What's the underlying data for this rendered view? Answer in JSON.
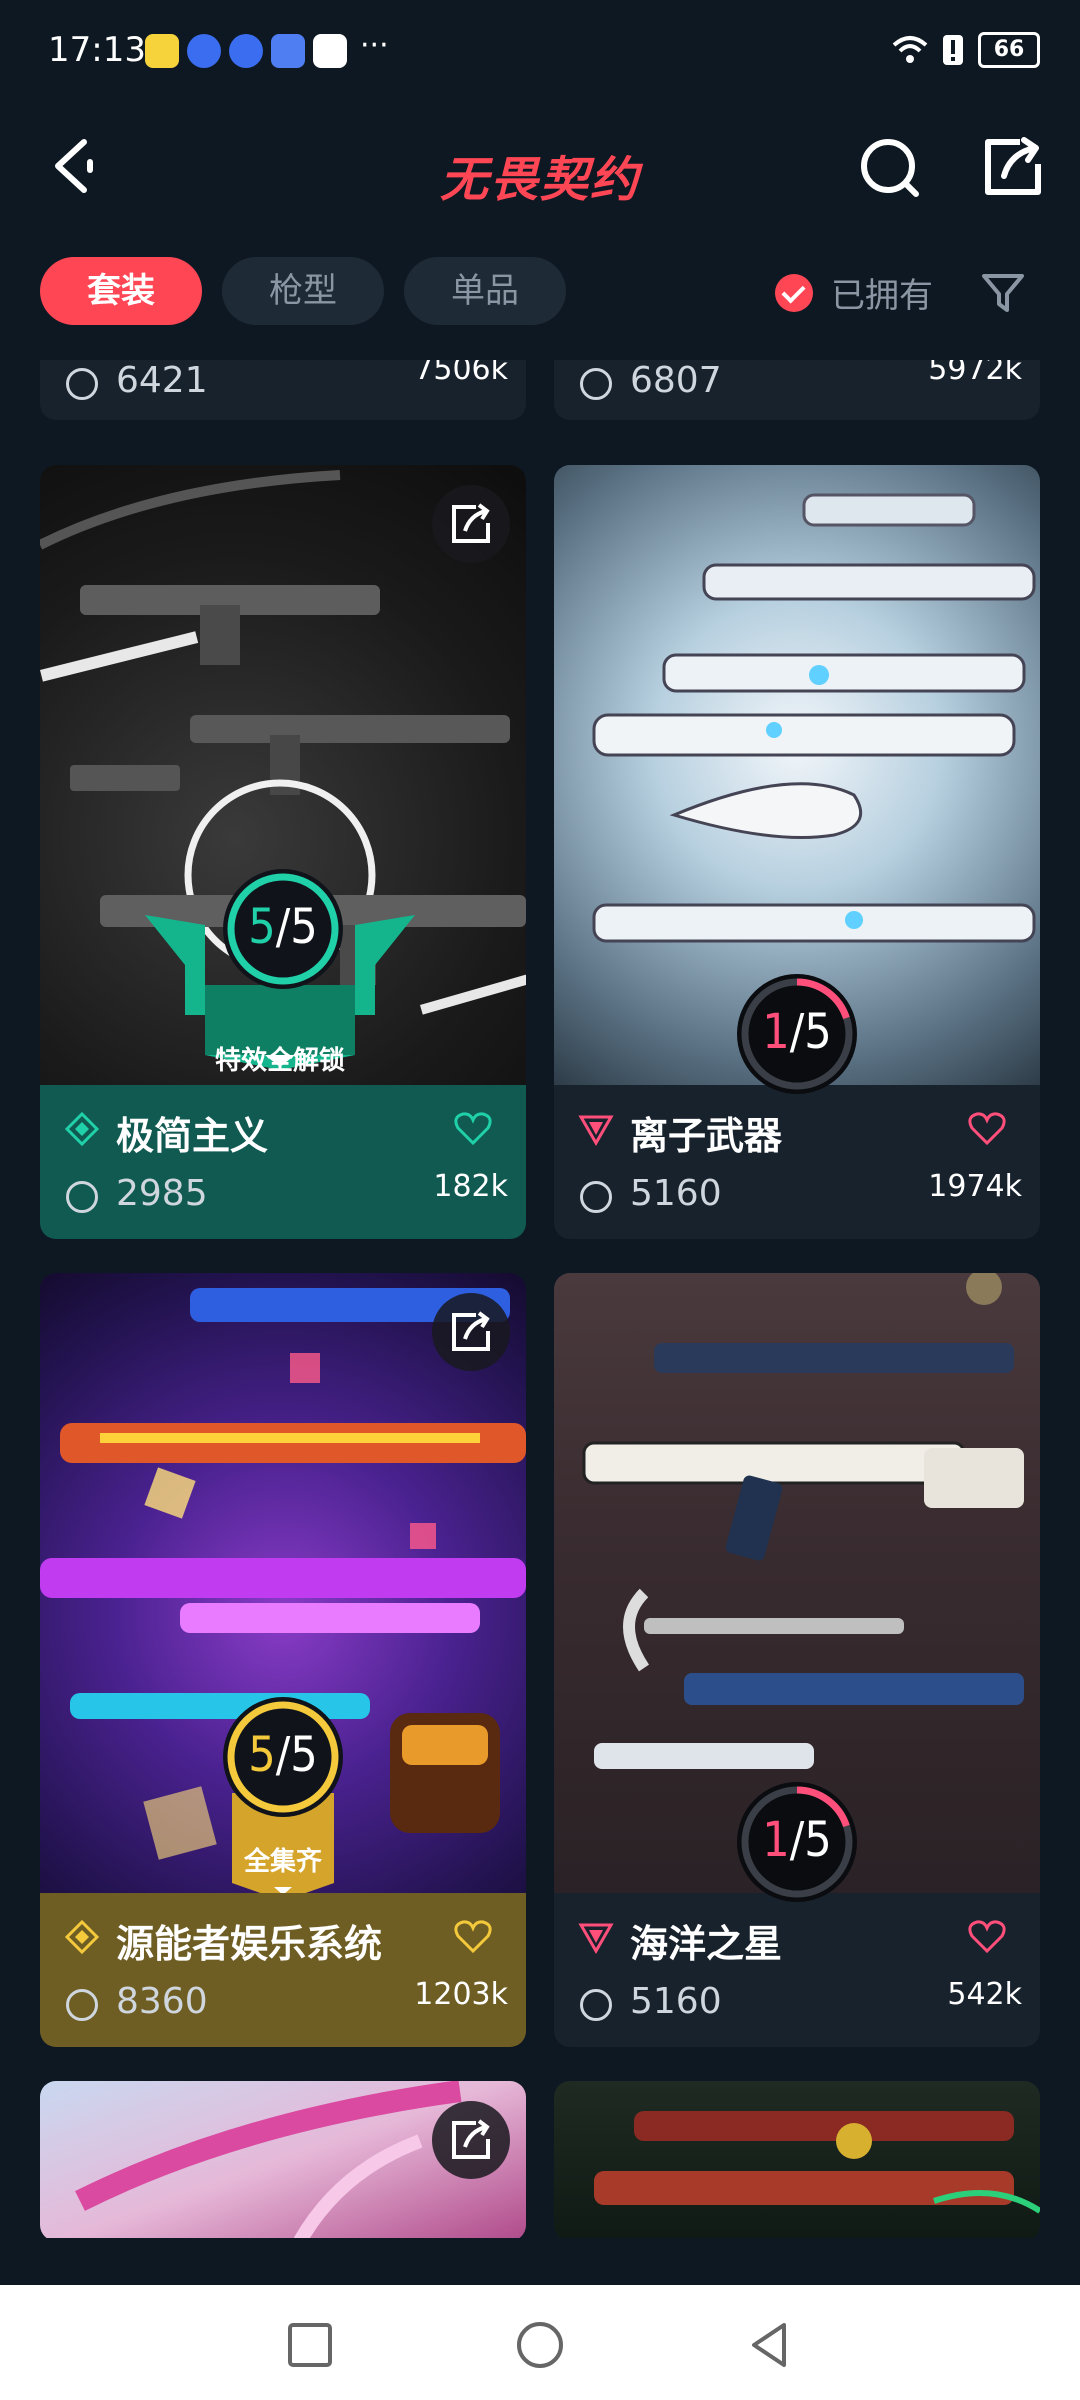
{
  "status_bar": {
    "time": "17:13",
    "more": "···",
    "battery": "66"
  },
  "header": {
    "title": "无畏契约"
  },
  "tabs": [
    {
      "label": "套装",
      "active": true
    },
    {
      "label": "枪型",
      "active": false
    },
    {
      "label": "单品",
      "active": false
    }
  ],
  "filter": {
    "owned_label": "已拥有"
  },
  "partial_cards": [
    {
      "price": "6421",
      "likes": "7506k"
    },
    {
      "price": "6807",
      "likes": "5972k"
    }
  ],
  "cards": [
    {
      "name": "极简主义",
      "price": "2985",
      "likes": "182k",
      "progress_owned": "5",
      "progress_total": "5",
      "ribbon": "特效全解锁",
      "theme": "green",
      "accent": "#1fd0a8"
    },
    {
      "name": "离子武器",
      "price": "5160",
      "likes": "1974k",
      "progress_owned": "1",
      "progress_total": "5",
      "ribbon": "",
      "theme": "dark",
      "accent": "#ff4f7a"
    },
    {
      "name": "源能者娱乐系统",
      "price": "8360",
      "likes": "1203k",
      "progress_owned": "5",
      "progress_total": "5",
      "ribbon": "全集齐",
      "theme": "gold",
      "accent": "#f4c93b"
    },
    {
      "name": "海洋之星",
      "price": "5160",
      "likes": "542k",
      "progress_owned": "1",
      "progress_total": "5",
      "ribbon": "",
      "theme": "dark",
      "accent": "#ff4f7a"
    }
  ],
  "colors": {
    "brand": "#ff4655",
    "background": "#0e1822",
    "card": "#18222d",
    "green": "#105a52",
    "gold": "#6f5e24"
  }
}
